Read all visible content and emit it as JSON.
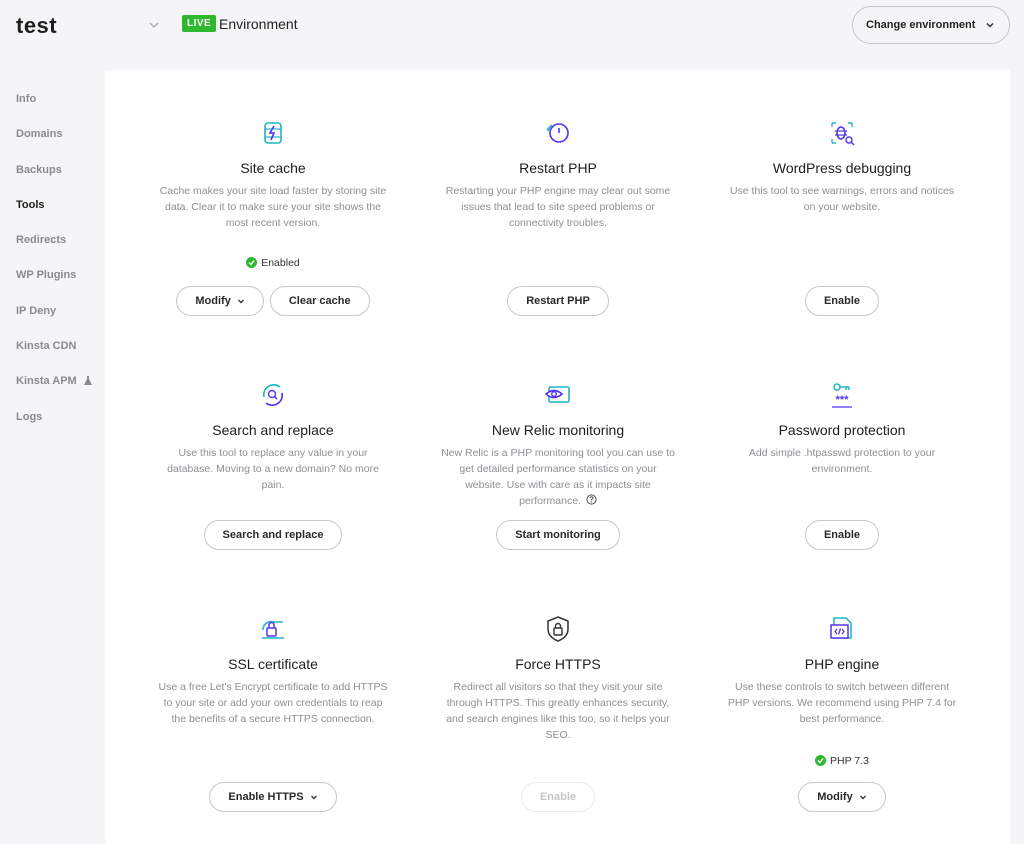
{
  "header": {
    "site_name": "test",
    "live_badge": "LIVE",
    "environment_label": "Environment",
    "change_environment": "Change environment"
  },
  "sidebar": {
    "items": [
      {
        "label": "Info"
      },
      {
        "label": "Domains"
      },
      {
        "label": "Backups"
      },
      {
        "label": "Tools"
      },
      {
        "label": "Redirects"
      },
      {
        "label": "WP Plugins"
      },
      {
        "label": "IP Deny"
      },
      {
        "label": "Kinsta CDN"
      },
      {
        "label": "Kinsta APM"
      },
      {
        "label": "Logs"
      }
    ]
  },
  "tools": {
    "site_cache": {
      "title": "Site cache",
      "desc": "Cache makes your site load faster by storing site data. Clear it to make sure your site shows the most recent version.",
      "status": "Enabled",
      "button1": "Modify",
      "button2": "Clear cache"
    },
    "restart_php": {
      "title": "Restart PHP",
      "desc": "Restarting your PHP engine may clear out some issues that lead to site speed problems or connectivity troubles.",
      "button1": "Restart PHP"
    },
    "wp_debug": {
      "title": "WordPress debugging",
      "desc": "Use this tool to see warnings, errors and notices on your website.",
      "button1": "Enable"
    },
    "search_replace": {
      "title": "Search and replace",
      "desc": "Use this tool to replace any value in your database. Moving to a new domain? No more pain.",
      "button1": "Search and replace"
    },
    "new_relic": {
      "title": "New Relic monitoring",
      "desc": "New Relic is a PHP monitoring tool you can use to get detailed performance statistics on your website. Use with care as it impacts site performance.",
      "button1": "Start monitoring"
    },
    "password": {
      "title": "Password protection",
      "desc": "Add simple .htpasswd protection to your environment.",
      "button1": "Enable"
    },
    "ssl": {
      "title": "SSL certificate",
      "desc": "Use a free Let's Encrypt certificate to add HTTPS to your site or add your own credentials to reap the benefits of a secure HTTPS connection.",
      "button1": "Enable HTTPS"
    },
    "force_https": {
      "title": "Force HTTPS",
      "desc": "Redirect all visitors so that they visit your site through HTTPS. This greatly enhances security, and search engines like this too, so it helps your SEO.",
      "button1": "Enable"
    },
    "php_engine": {
      "title": "PHP engine",
      "desc": "Use these controls to switch between different PHP versions. We recommend using PHP 7.4 for best performance.",
      "status": "PHP 7.3",
      "button1": "Modify"
    }
  },
  "colors": {
    "accent": "#5333ed",
    "teal": "#1fb5c4",
    "live_green": "#2eb82e"
  },
  "icons": {
    "site_cache": "cache-bolt-icon",
    "restart_php": "power-restart-icon",
    "wp_debug": "bug-search-icon",
    "search_replace": "search-replace-icon",
    "new_relic": "eye-monitor-icon",
    "password": "key-password-icon",
    "ssl": "ssl-lock-icon",
    "force_https": "shield-lock-icon",
    "php_engine": "php-file-icon"
  }
}
